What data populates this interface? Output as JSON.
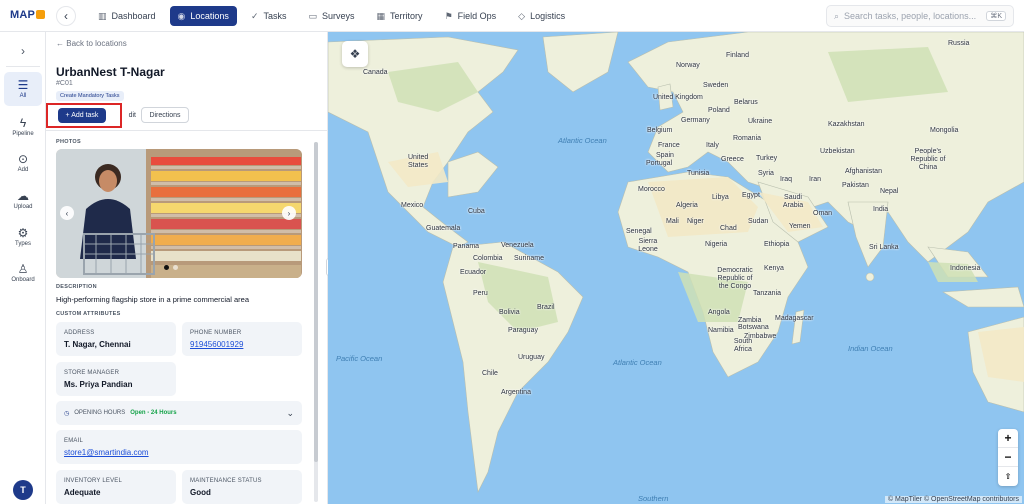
{
  "app": {
    "logo_text": "MAP"
  },
  "nav": [
    {
      "label": "Dashboard",
      "icon": "chart-icon"
    },
    {
      "label": "Locations",
      "icon": "pin-icon",
      "active": true
    },
    {
      "label": "Tasks",
      "icon": "check-icon"
    },
    {
      "label": "Surveys",
      "icon": "clipboard-icon"
    },
    {
      "label": "Territory",
      "icon": "map-icon"
    },
    {
      "label": "Field Ops",
      "icon": "flag-icon"
    },
    {
      "label": "Logistics",
      "icon": "box-icon"
    }
  ],
  "search": {
    "placeholder": "Search tasks, people, locations...",
    "shortcut": "⌘K"
  },
  "rail": [
    {
      "label": "All",
      "icon": "list-icon",
      "active": true
    },
    {
      "label": "Pipeline",
      "icon": "bolt-icon"
    },
    {
      "label": "Add",
      "icon": "pin-add-icon"
    },
    {
      "label": "Upload",
      "icon": "upload-icon"
    },
    {
      "label": "Types",
      "icon": "gear-icon"
    },
    {
      "label": "Onboard",
      "icon": "user-icon"
    }
  ],
  "user": {
    "initial": "T"
  },
  "detail": {
    "back_label": "Back to locations",
    "title": "UrbanNest T-Nagar",
    "code": "#C01",
    "chip": "Create Mandatory Tasks",
    "add_task": "+ Add task",
    "edit": "dit",
    "directions": "Directions",
    "photos_label": "PHOTOS",
    "description_label": "DESCRIPTION",
    "description": "High-performing flagship store in a prime commercial area",
    "custom_attrs_label": "CUSTOM ATTRIBUTES",
    "address_label": "ADDRESS",
    "address": "T. Nagar, Chennai",
    "phone_label": "PHONE NUMBER",
    "phone": "919456001929",
    "manager_label": "STORE MANAGER",
    "manager": "Ms. Priya Pandian",
    "hours_label": "OPENING HOURS",
    "hours_value": "Open - 24 Hours",
    "email_label": "EMAIL",
    "email": "store1@smartindia.com",
    "inventory_label": "INVENTORY LEVEL",
    "inventory": "Adequate",
    "maintenance_label": "MAINTENANCE STATUS",
    "maintenance": "Good"
  },
  "map": {
    "attribution": "© MapTiler © OpenStreetMap contributors",
    "zoom_in": "+",
    "zoom_out": "−",
    "compass": "⇧",
    "oceans": [
      "Atlantic Ocean",
      "Pacific Ocean",
      "Atlantic Ocean",
      "Indian Ocean",
      "Southern"
    ],
    "labels": [
      "Russia",
      "Canada",
      "Finland",
      "Sweden",
      "Norway",
      "United Kingdom",
      "Belarus",
      "Poland",
      "Ukraine",
      "Germany",
      "Belgium",
      "France",
      "Romania",
      "Kazakhstan",
      "Mongolia",
      "Italy",
      "Spain",
      "Portugal",
      "Greece",
      "Turkey",
      "Uzbekistan",
      "People's Republic of China",
      "United States",
      "Tunisia",
      "Syria",
      "Iraq",
      "Iran",
      "Afghanistan",
      "Pakistan",
      "Nepal",
      "Morocco",
      "Libya",
      "Egypt",
      "Algeria",
      "Saudi Arabia",
      "Oman",
      "India",
      "Mexico",
      "Cuba",
      "Mali",
      "Niger",
      "Sudan",
      "Chad",
      "Yemen",
      "Guatemala",
      "Senegal",
      "Sierra Leone",
      "Nigeria",
      "Ethiopia",
      "Sri Lanka",
      "Panama",
      "Venezuela",
      "Colombia",
      "Suriname",
      "Ecuador",
      "Kenya",
      "Democratic Republic of the Congo",
      "Tanzania",
      "Peru",
      "Brazil",
      "Indonesia",
      "Bolivia",
      "Paraguay",
      "Angola",
      "Zambia",
      "Madagascar",
      "Namibia",
      "Zimbabwe",
      "South Africa",
      "Uruguay",
      "Chile",
      "Argentina",
      "Botswana"
    ]
  }
}
